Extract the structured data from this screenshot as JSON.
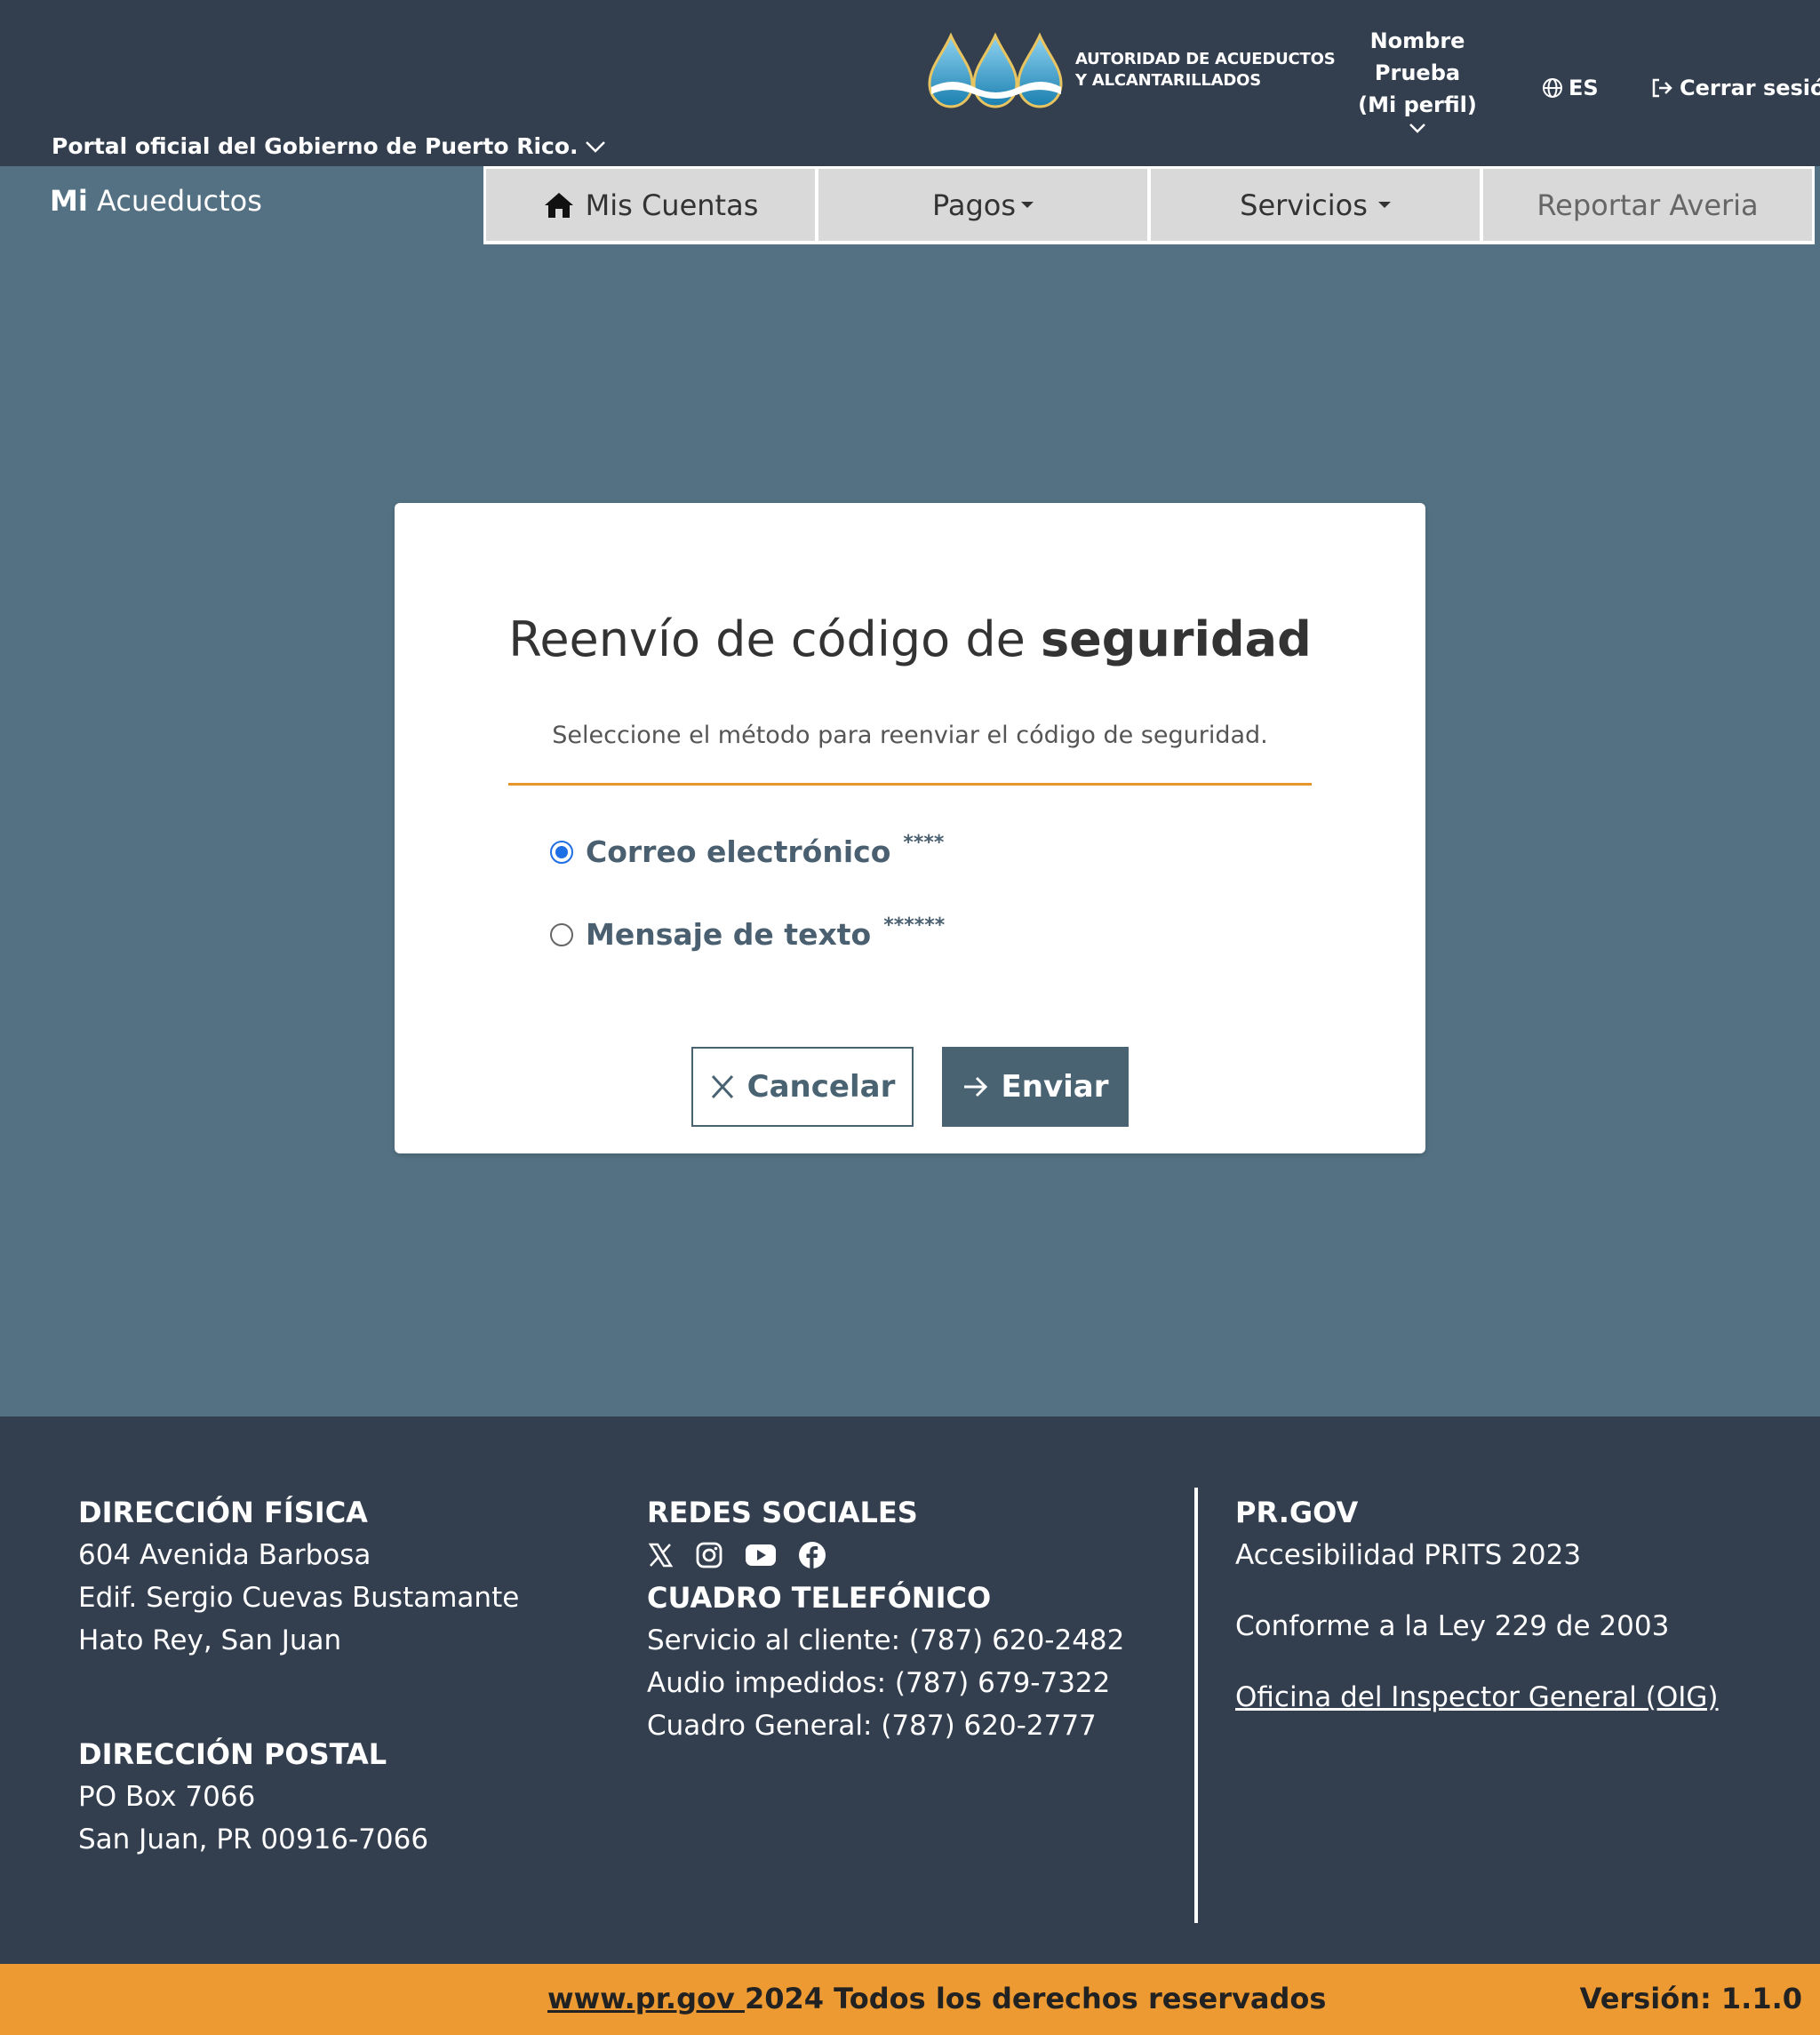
{
  "header": {
    "gov_portal": "Portal oficial del Gobierno de Puerto Rico.",
    "logo_line1": "AUTORIDAD DE ACUEDUCTOS",
    "logo_line2": "Y ALCANTARILLADOS",
    "user_line1": "Nombre",
    "user_line2": "Prueba",
    "user_line3": "(Mi perfil)",
    "language": "ES",
    "logout": "Cerrar sesión"
  },
  "nav": {
    "brand_bold": "Mi",
    "brand_rest": "Acueductos",
    "tabs": [
      {
        "label": "Mis Cuentas"
      },
      {
        "label": "Pagos"
      },
      {
        "label": "Servicios"
      },
      {
        "label": "Reportar Averia"
      }
    ]
  },
  "card": {
    "title_regular": "Reenvío de código de",
    "title_bold": "seguridad",
    "subtitle": "Seleccione el método para reenviar el código de seguridad.",
    "options": [
      {
        "label": "Correo electrónico",
        "mask": "****",
        "checked": true
      },
      {
        "label": "Mensaje de texto",
        "mask": "******",
        "checked": false
      }
    ],
    "cancel_label": "Cancelar",
    "send_label": "Enviar"
  },
  "footer": {
    "physical_title": "DIRECCIÓN FÍSICA",
    "physical_lines": [
      "604 Avenida Barbosa",
      "Edif. Sergio Cuevas Bustamante",
      "Hato Rey, San Juan"
    ],
    "postal_title": "DIRECCIÓN POSTAL",
    "postal_lines": [
      "PO Box 7066",
      "San Juan, PR 00916-7066"
    ],
    "social_title": "REDES SOCIALES",
    "social_icons": [
      "x-icon",
      "instagram-icon",
      "youtube-icon",
      "facebook-icon"
    ],
    "phone_title": "CUADRO TELEFÓNICO",
    "phone_lines": [
      "Servicio al cliente: (787) 620-2482",
      "Audio impedidos: (787) 679-7322",
      "Cuadro General: (787) 620-2777"
    ],
    "prgov_title": "PR.GOV",
    "prgov_links": [
      "Accesibilidad PRITS 2023",
      "Conforme a la Ley 229 de 2003",
      "Oficina del Inspector General (OIG)"
    ]
  },
  "bottom": {
    "site_link": "www.pr.gov ",
    "rights": "2024 Todos los derechos reservados",
    "version": "Versión: 1.1.0"
  },
  "colors": {
    "header_bg": "#333f4f",
    "page_bg": "#537183",
    "accent_orange": "#ee9a33",
    "button_bg": "#4a6373",
    "radio_checked": "#1f6fe5"
  }
}
